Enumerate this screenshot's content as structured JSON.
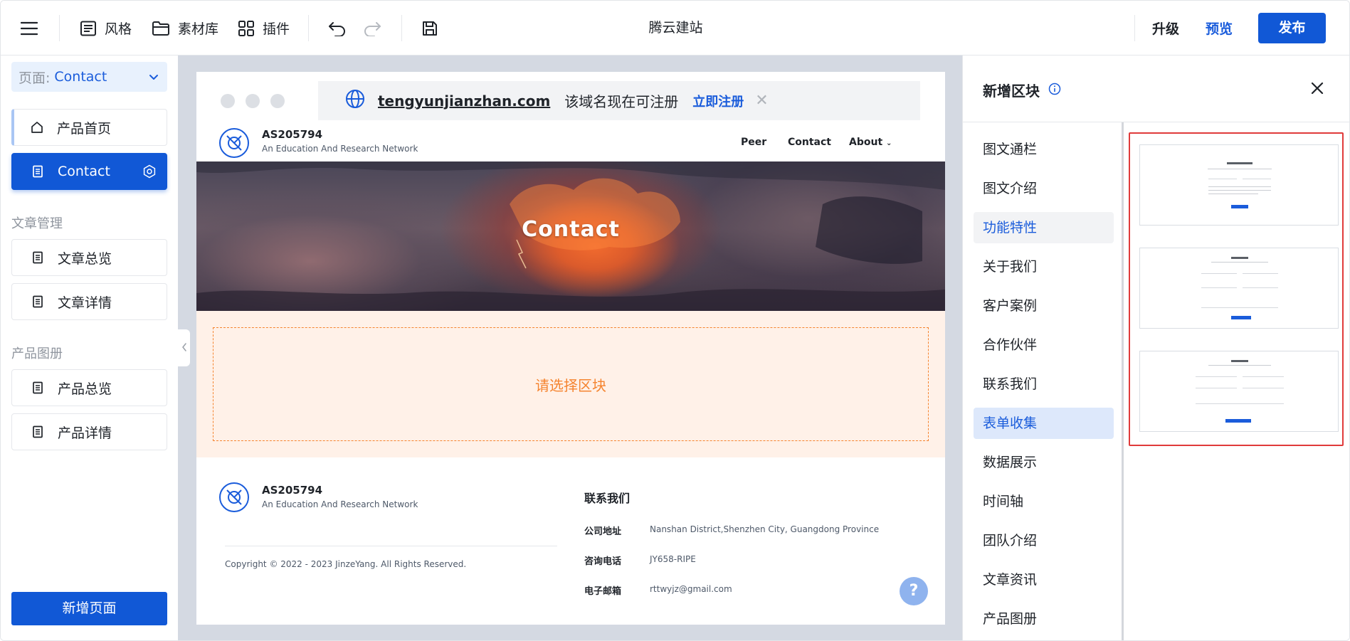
{
  "topbar": {
    "style_label": "风格",
    "assets_label": "素材库",
    "plugins_label": "插件",
    "app_title": "腾云建站",
    "upgrade_label": "升级",
    "preview_label": "预览",
    "publish_label": "发布"
  },
  "sidebar": {
    "page_prefix": "页面:",
    "page_value": "Contact",
    "pages": [
      {
        "label": "产品首页",
        "icon": "home-icon"
      },
      {
        "label": "Contact",
        "icon": "document-icon",
        "active": true
      }
    ],
    "sections": [
      {
        "title": "文章管理",
        "items": [
          "文章总览",
          "文章详情"
        ]
      },
      {
        "title": "产品图册",
        "items": [
          "产品总览",
          "产品详情"
        ]
      }
    ],
    "new_page_label": "新增页面"
  },
  "preview": {
    "domain_name": "tengyunjianzhan.com",
    "domain_msg": "该域名现在可注册",
    "register_label": "立即注册",
    "close_glyph": "✕",
    "site_name": "AS205794",
    "site_subtitle": "An Education And Research Network",
    "menu": [
      "Peer",
      "Contact",
      "About"
    ],
    "hero_title": "Contact",
    "select_block_text": "请选择区块",
    "footer": {
      "site_name": "AS205794",
      "site_subtitle": "An Education And Research Network",
      "copyright": "Copyright © 2022 - 2023 JinzeYang. All Rights Reserved.",
      "contact_heading": "联系我们",
      "address_label": "公司地址",
      "address_value": "Nanshan District,Shenzhen City, Guangdong Province",
      "phone_label": "咨询电话",
      "phone_value": "JY658-RIPE",
      "email_label": "电子邮箱",
      "email_value": "rttwyjz@gmail.com",
      "help_glyph": "?"
    }
  },
  "panel": {
    "title": "新增区块",
    "categories": [
      "图文通栏",
      "图文介绍",
      "功能特性",
      "关于我们",
      "客户案例",
      "合作伙伴",
      "联系我们",
      "表单收集",
      "数据展示",
      "时间轴",
      "团队介绍",
      "文章资讯",
      "产品图册"
    ],
    "hovered_category": "功能特性",
    "selected_category": "表单收集"
  },
  "colors": {
    "brand_blue": "#1158d6",
    "accent_orange": "#f5842f",
    "highlight_red": "#e03b3b"
  }
}
